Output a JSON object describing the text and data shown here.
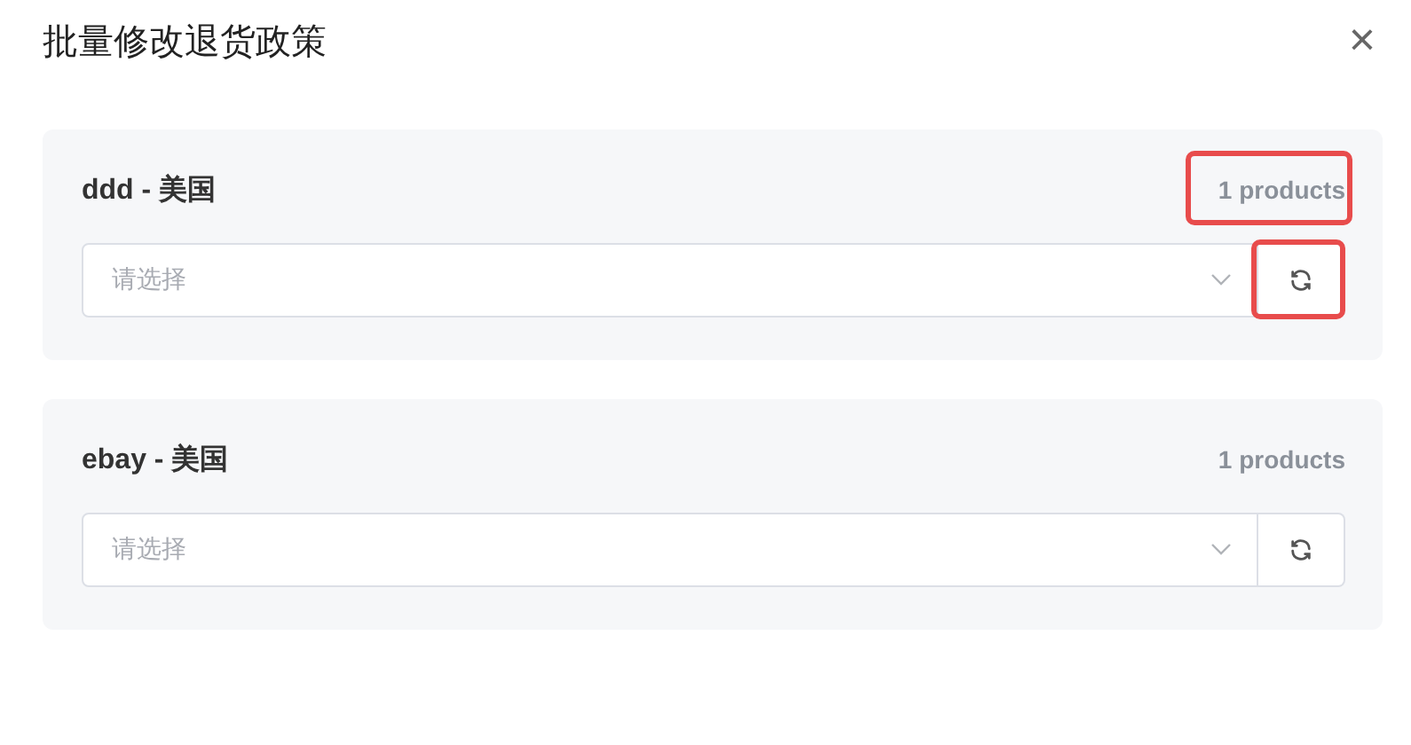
{
  "dialog": {
    "title": "批量修改退货政策",
    "close": "×"
  },
  "stores": [
    {
      "name": "ddd - 美国",
      "count": "1 products",
      "placeholder": "请选择",
      "count_highlighted": true,
      "refresh_highlighted": true
    },
    {
      "name": "ebay - 美国",
      "count": "1 products",
      "placeholder": "请选择",
      "count_highlighted": false,
      "refresh_highlighted": false
    }
  ]
}
